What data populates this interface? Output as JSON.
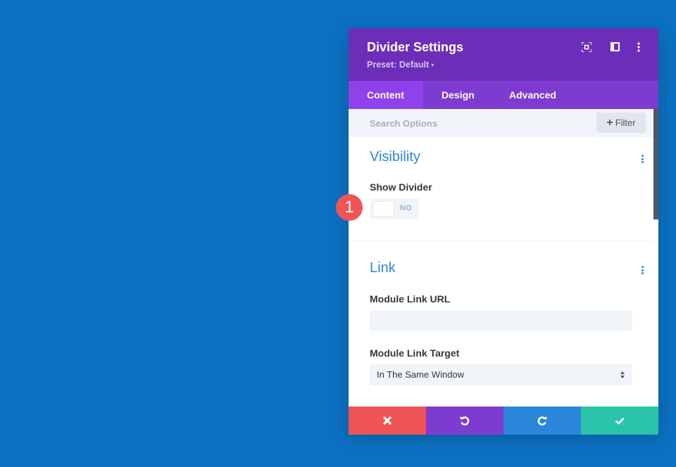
{
  "modal": {
    "title": "Divider Settings",
    "preset_label": "Preset: Default",
    "preset_caret": "▾",
    "header_icons": [
      "fullscreen-icon",
      "split-view-icon",
      "more-options-icon"
    ]
  },
  "tabs": [
    {
      "label": "Content",
      "active": true
    },
    {
      "label": "Design",
      "active": false
    },
    {
      "label": "Advanced",
      "active": false
    }
  ],
  "search": {
    "placeholder": "Search Options",
    "value": "",
    "filter_label": "Filter",
    "filter_icon": "+"
  },
  "sections": {
    "visibility": {
      "title": "Visibility",
      "show_divider_label": "Show Divider",
      "show_divider_value": "NO"
    },
    "link": {
      "title": "Link",
      "url_label": "Module Link URL",
      "url_value": "",
      "target_label": "Module Link Target",
      "target_value": "In The Same Window"
    }
  },
  "footer": {
    "cancel_color": "#ef5555",
    "undo_color": "#7e3bd0",
    "redo_color": "#2b87da",
    "save_color": "#29c4a9"
  },
  "annotation": {
    "badge_number": "1"
  },
  "colors": {
    "background": "#0c71c3",
    "header": "#6c2eb9",
    "tabs": "#7e3bd0",
    "active_tab": "#8f42ec",
    "accent": "#2b87da"
  }
}
